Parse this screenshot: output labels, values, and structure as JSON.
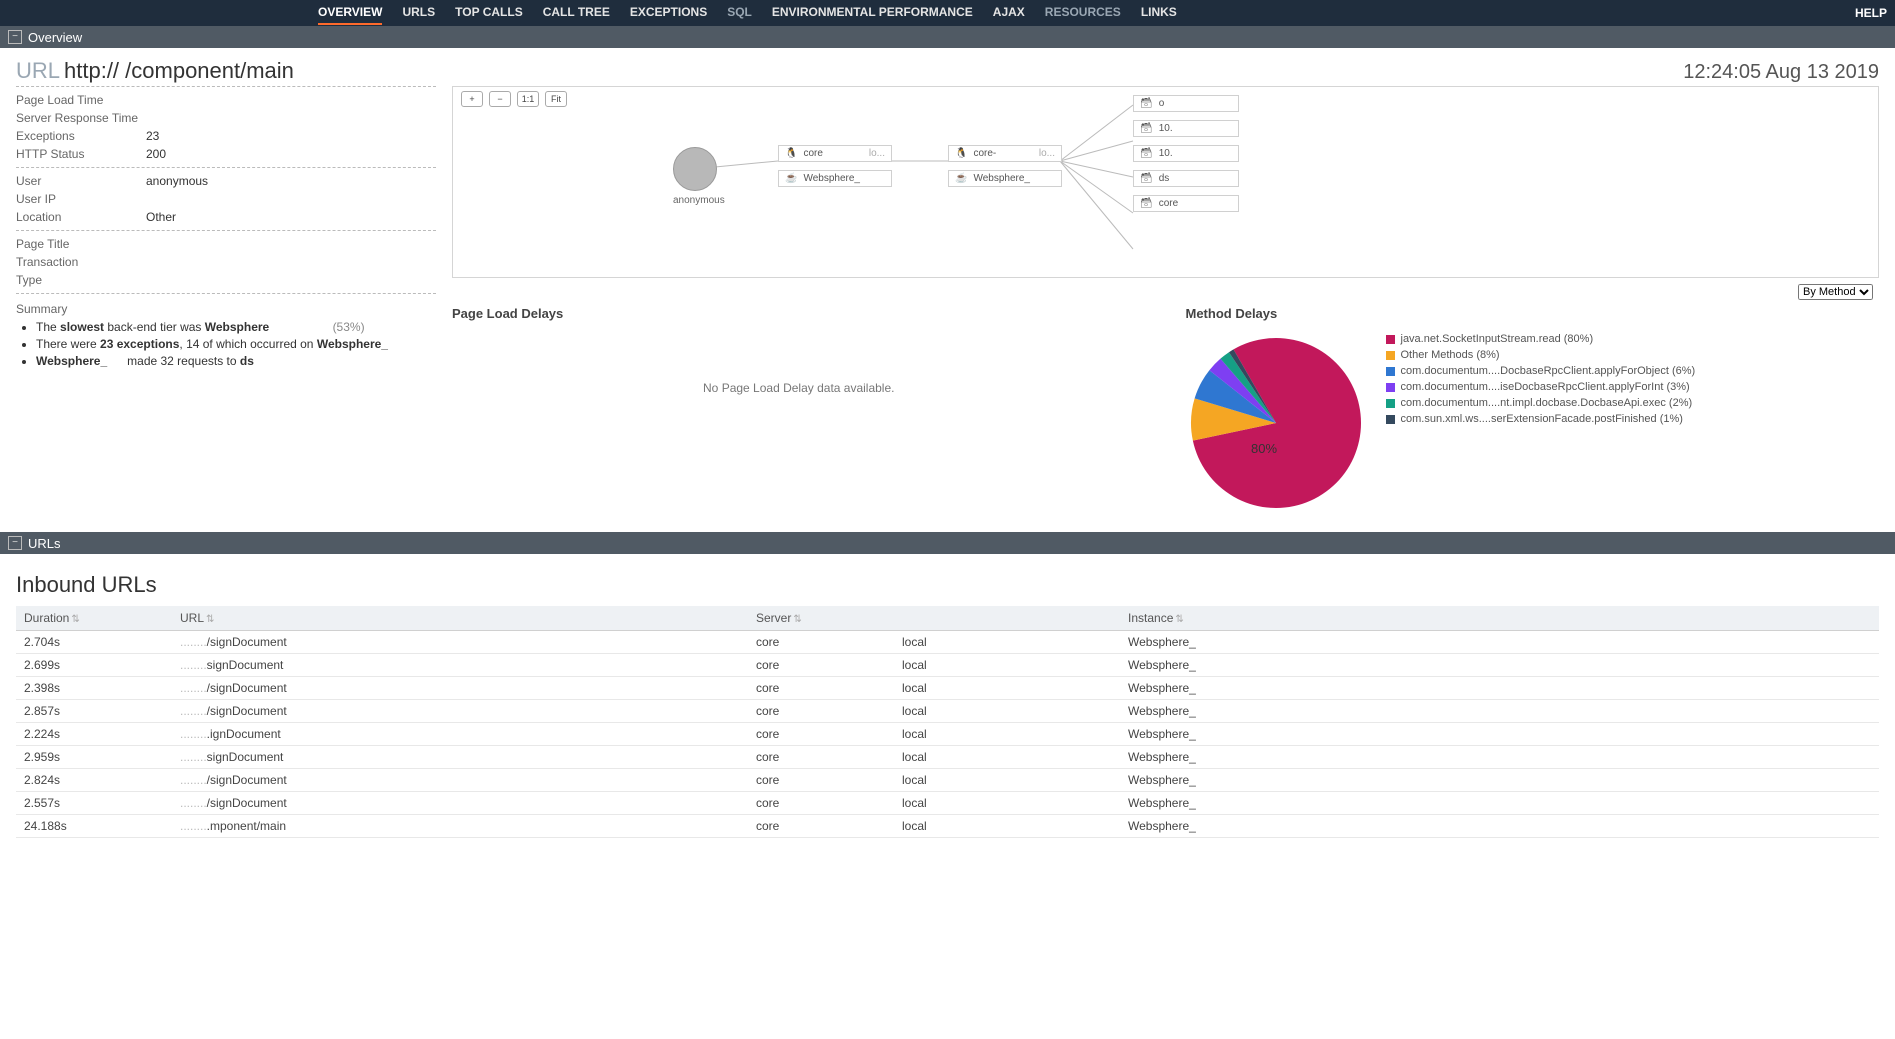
{
  "nav": {
    "tabs": [
      {
        "label": "OVERVIEW",
        "active": true
      },
      {
        "label": "URLS"
      },
      {
        "label": "TOP CALLS"
      },
      {
        "label": "CALL TREE"
      },
      {
        "label": "EXCEPTIONS"
      },
      {
        "label": "SQL",
        "dim": true
      },
      {
        "label": "ENVIRONMENTAL PERFORMANCE"
      },
      {
        "label": "AJAX"
      },
      {
        "label": "RESOURCES",
        "dim": true
      },
      {
        "label": "LINKS"
      }
    ],
    "help": "HELP"
  },
  "sections": {
    "overview_title": "Overview",
    "urls_title": "URLs"
  },
  "header": {
    "url_label": "URL",
    "url_value": "http://                                                     /component/main",
    "timestamp": "12:24:05 Aug 13 2019"
  },
  "details": {
    "groups": [
      [
        {
          "k": "Page Load Time",
          "v": ""
        },
        {
          "k": "Server Response Time",
          "v": ""
        },
        {
          "k": "Exceptions",
          "v": "23"
        },
        {
          "k": "HTTP Status",
          "v": "200"
        }
      ],
      [
        {
          "k": "User",
          "v": "anonymous"
        },
        {
          "k": "User IP",
          "v": ""
        },
        {
          "k": "Location",
          "v": "Other"
        }
      ],
      [
        {
          "k": "Page Title",
          "v": ""
        },
        {
          "k": "Transaction",
          "v": ""
        },
        {
          "k": "Type",
          "v": ""
        }
      ]
    ],
    "summary_label": "Summary",
    "summary_html": [
      "The <b>slowest</b> back-end tier was <b>Websphere</b> <span class='pct'>(53%)</span>",
      "There were <b>23 exceptions</b>, 14 of which occurred on <b>Websphere_</b>",
      "<b>Websphere_</b>&nbsp;&nbsp;&nbsp;&nbsp;&nbsp;&nbsp;made 32 requests to <b>ds</b>"
    ]
  },
  "topology": {
    "user_label": "anonymous",
    "col_a": [
      {
        "icon": "linux",
        "label": "core",
        "suffix": "lo..."
      },
      {
        "icon": "java",
        "label": "Websphere_",
        "suffix": ""
      }
    ],
    "col_b": [
      {
        "icon": "linux",
        "label": "core-",
        "suffix": "lo..."
      },
      {
        "icon": "java",
        "label": "Websphere_",
        "suffix": ""
      }
    ],
    "col_c": [
      {
        "icon": "db",
        "label": "o"
      },
      {
        "icon": "db",
        "label": "10."
      },
      {
        "icon": "db",
        "label": "10."
      },
      {
        "icon": "db",
        "label": "ds"
      },
      {
        "icon": "db",
        "label": "core"
      }
    ],
    "tools": {
      "zoom_in": "+",
      "zoom_out": "−",
      "one_one": "1:1",
      "fit": "Fit"
    }
  },
  "dropdown": {
    "selected": "By Method"
  },
  "page_load_delays": {
    "title": "Page Load Delays",
    "empty": "No Page Load Delay data available."
  },
  "method_delays": {
    "title": "Method Delays",
    "center_label": "80%"
  },
  "chart_data": {
    "type": "pie",
    "title": "Method Delays",
    "series": [
      {
        "name": "java.net.SocketInputStream.read",
        "pct": 80,
        "color": "#c2185b"
      },
      {
        "name": "Other Methods",
        "pct": 8,
        "color": "#f5a623"
      },
      {
        "name": "com.documentum....DocbaseRpcClient.applyForObject",
        "pct": 6,
        "color": "#2f77d1"
      },
      {
        "name": "com.documentum....iseDocbaseRpcClient.applyForInt",
        "pct": 3,
        "color": "#7e3ff2"
      },
      {
        "name": "com.documentum....nt.impl.docbase.DocbaseApi.exec",
        "pct": 2,
        "color": "#15a085"
      },
      {
        "name": "com.sun.xml.ws....serExtensionFacade.postFinished",
        "pct": 1,
        "color": "#34495e"
      }
    ]
  },
  "urls": {
    "heading": "Inbound URLs",
    "columns": [
      "Duration",
      "URL",
      "Server",
      "",
      "Instance"
    ],
    "rows": [
      {
        "duration": "2.704s",
        "url": "/signDocument",
        "server": "core",
        "extra": "local",
        "instance": "Websphere_"
      },
      {
        "duration": "2.699s",
        "url": "signDocument",
        "server": "core",
        "extra": "local",
        "instance": "Websphere_"
      },
      {
        "duration": "2.398s",
        "url": "/signDocument",
        "server": "core",
        "extra": "local",
        "instance": "Websphere_"
      },
      {
        "duration": "2.857s",
        "url": "/signDocument",
        "server": "core",
        "extra": "local",
        "instance": "Websphere_"
      },
      {
        "duration": "2.224s",
        "url": ".ignDocument",
        "server": "core",
        "extra": "local",
        "instance": "Websphere_"
      },
      {
        "duration": "2.959s",
        "url": "signDocument",
        "server": "core",
        "extra": "local",
        "instance": "Websphere_"
      },
      {
        "duration": "2.824s",
        "url": "/signDocument",
        "server": "core",
        "extra": "local",
        "instance": "Websphere_"
      },
      {
        "duration": "2.557s",
        "url": "/signDocument",
        "server": "core",
        "extra": "local",
        "instance": "Websphere_"
      },
      {
        "duration": "24.188s",
        "url": ".mponent/main",
        "server": "core",
        "extra": "local",
        "instance": "Websphere_"
      }
    ]
  }
}
